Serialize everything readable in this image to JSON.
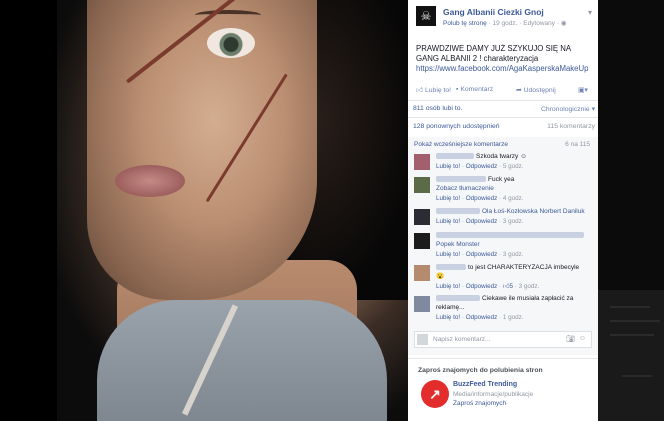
{
  "page": {
    "name": "Gang Albanii Ciezki Gnoj",
    "follow_label": "Polub tę stronę",
    "time": "19 godz.",
    "edited": "Edytowany",
    "post_text": "PRAWDZIWE DAMY JUŻ SZYKUJO SIĘ NA GANG ALBANII 2 ! charakteryzacja",
    "post_link": "https://www.facebook.com/AgaKasperskaMakeUp"
  },
  "actions": {
    "like": "Lubię to!",
    "comment": "Komentarz",
    "share": "Udostępnij"
  },
  "stats": {
    "likes": "811 osób lubi to.",
    "order": "Chronologicznie",
    "shares": "128 ponownych udostępnień",
    "comments_total": "115 komentarzy"
  },
  "comments": {
    "show_previous": "Pokaż wcześniejsze komentarze",
    "range": "6 na 115",
    "items": [
      {
        "text": "Szkoda twarzy",
        "like": "Lubię to!",
        "reply": "Odpowiedz",
        "time": "5 godz."
      },
      {
        "text": "Fuck yea",
        "tag": "Zobacz tłumaczenie",
        "like": "Lubię to!",
        "reply": "Odpowiedz",
        "time": "4 godz."
      },
      {
        "text": "Ola Łoś-Kozłowska Norbert Daniluk",
        "like": "Lubię to!",
        "reply": "Odpowiedz",
        "time": "3 godz."
      },
      {
        "text": "Popek Monster",
        "like": "Lubię to!",
        "reply": "Odpowiedz",
        "time": "3 godz."
      },
      {
        "text": "to jest CHARAKTERYZACJA imbecyle",
        "like": "Lubię to!",
        "reply": "Odpowiedz",
        "likes": "5",
        "time": "3 godz."
      },
      {
        "text": "Ciekawe ile musiała zapłacić za reklamę...",
        "like": "Lubię to!",
        "reply": "Odpowiedz",
        "time": "1 godz."
      }
    ],
    "input_placeholder": "Napisz komentarz..."
  },
  "suggest": {
    "heading": "Zaproś znajomych do polubienia stron",
    "name": "BuzzFeed Trending",
    "category": "Media/informacje/publikacje",
    "invite": "Zaproś znajomych"
  }
}
